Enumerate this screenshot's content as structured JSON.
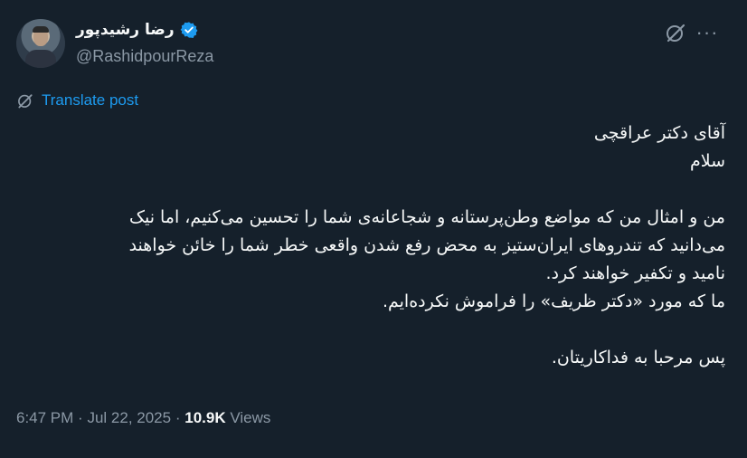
{
  "author": {
    "display_name": "رضا رشیدپور",
    "handle": "@RashidpourReza",
    "verified_color": "#1d9bf0"
  },
  "actions": {
    "grok_icon": "grok-icon",
    "more_label": "···"
  },
  "translate": {
    "label": "Translate post"
  },
  "tweet": {
    "lines": [
      "آقای دکتر عراقچی",
      "سلام",
      "",
      "من و امثال من که مواضع وطن‌پرستانه و شجاعانه‌ی شما را تحسین می‌کنیم، اما نیک",
      "می‌دانید که تندروهای ایران‌ستیز به محض رفع شدن واقعی خطر شما را خائن خواهند",
      "نامید و تکفیر خواهند کرد.",
      "ما که مورد «دکتر ظریف» را فراموش نکرده‌ایم.",
      "",
      "پس مرحبا به فداکاریتان."
    ]
  },
  "meta": {
    "time": "6:47 PM",
    "date": "Jul 22, 2025",
    "separator": "·",
    "views_count": "10.9K",
    "views_label": "Views"
  },
  "colors": {
    "background": "#15202b",
    "text": "#f7f9f9",
    "secondary": "#8b98a5",
    "accent": "#1d9bf0"
  }
}
